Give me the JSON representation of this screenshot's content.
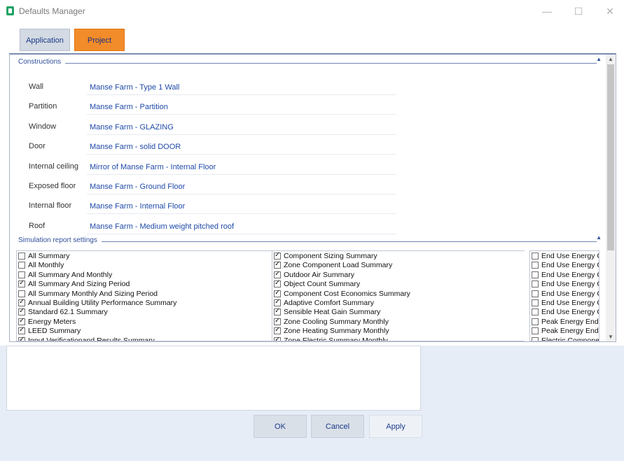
{
  "window": {
    "title": "Defaults Manager",
    "minimize": "—",
    "maximize": "☐",
    "close": "✕"
  },
  "tabs": [
    {
      "label": "Application"
    },
    {
      "label": "Project",
      "active": true
    }
  ],
  "constructions": {
    "header": "Constructions",
    "rows": [
      {
        "label": "Wall",
        "value": "Manse Farm - Type 1 Wall"
      },
      {
        "label": "Partition",
        "value": "Manse Farm - Partition"
      },
      {
        "label": "Window",
        "value": "Manse Farm - GLAZING"
      },
      {
        "label": "Door",
        "value": "Manse Farm - solid DOOR"
      },
      {
        "label": "Internal ceiling",
        "value": "Mirror of Manse Farm - Internal Floor"
      },
      {
        "label": "Exposed floor",
        "value": "Manse Farm - Ground Floor"
      },
      {
        "label": "Internal floor",
        "value": "Manse Farm - Internal Floor"
      },
      {
        "label": "Roof",
        "value": "Manse Farm - Medium weight pitched roof"
      }
    ]
  },
  "simulation": {
    "header": "Simulation report settings",
    "col1": [
      {
        "label": "All Summary",
        "checked": false
      },
      {
        "label": "All Monthly",
        "checked": false
      },
      {
        "label": "All Summary And Monthly",
        "checked": false
      },
      {
        "label": "All Summary And Sizing Period",
        "checked": true
      },
      {
        "label": "All Summary Monthly And Sizing Period",
        "checked": false
      },
      {
        "label": "Annual Building Utility Performance Summary",
        "checked": true
      },
      {
        "label": "Standard 62.1 Summary",
        "checked": true
      },
      {
        "label": "Energy Meters",
        "checked": true
      },
      {
        "label": "LEED Summary",
        "checked": true
      },
      {
        "label": "Input Verificationand Results Summary",
        "checked": true
      }
    ],
    "col2": [
      {
        "label": "Component Sizing Summary",
        "checked": true
      },
      {
        "label": "Zone Component Load Summary",
        "checked": true
      },
      {
        "label": "Outdoor Air Summary",
        "checked": true
      },
      {
        "label": "Object Count Summary",
        "checked": true
      },
      {
        "label": "Component Cost Economics Summary",
        "checked": true
      },
      {
        "label": "Adaptive Comfort Summary",
        "checked": true
      },
      {
        "label": "Sensible Heat Gain Summary",
        "checked": true
      },
      {
        "label": "Zone Cooling Summary Monthly",
        "checked": true
      },
      {
        "label": "Zone Heating Summary Monthly",
        "checked": true
      },
      {
        "label": "Zone Electric Summary Monthly",
        "checked": true
      }
    ],
    "col3": [
      {
        "label": "End Use Energy C",
        "checked": false
      },
      {
        "label": "End Use Energy C",
        "checked": false
      },
      {
        "label": "End Use Energy C",
        "checked": false
      },
      {
        "label": "End Use Energy C",
        "checked": false
      },
      {
        "label": "End Use Energy C",
        "checked": false
      },
      {
        "label": "End Use Energy C",
        "checked": false
      },
      {
        "label": "End Use Energy C",
        "checked": false
      },
      {
        "label": "Peak Energy End",
        "checked": false
      },
      {
        "label": "Peak Energy End",
        "checked": false
      },
      {
        "label": "Electric Componen",
        "checked": false
      }
    ]
  },
  "buttons": {
    "ok": "OK",
    "cancel": "Cancel",
    "apply": "Apply"
  },
  "colors": {
    "accent_tab": "#f28c2a",
    "link_text": "#1f4aa8",
    "header_text": "#2f4f9a"
  }
}
